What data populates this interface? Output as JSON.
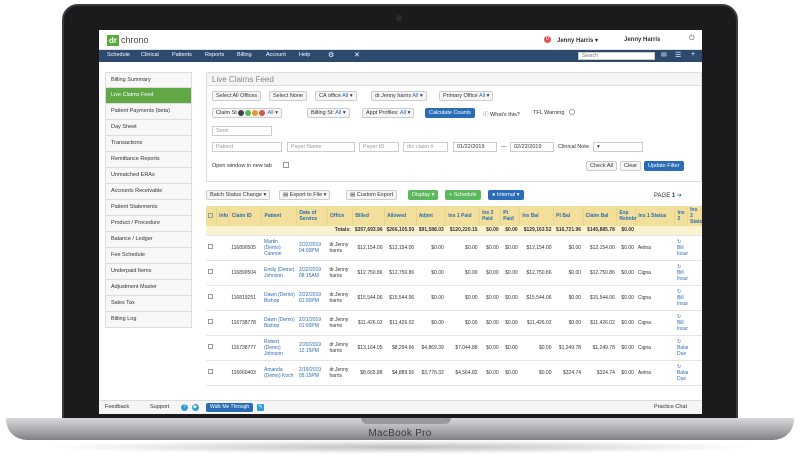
{
  "device": {
    "label": "MacBook Pro"
  },
  "app": {
    "logo_dr": "dr",
    "logo_chrono": "chrono",
    "notification_count": "0",
    "user_left": "Jenny Harris",
    "user_right": "Jenny Harris"
  },
  "nav": {
    "items": [
      "Schedule",
      "Clinical",
      "Patients",
      "Reports",
      "Billing",
      "Account",
      "Help"
    ],
    "search_placeholder": "Search"
  },
  "sidebar": {
    "items": [
      "Billing Summary",
      "Live Claims Feed",
      "Patient Payments (beta)",
      "Day Sheet",
      "Transactions",
      "Remittance Reports",
      "Unmatched ERAs",
      "Accounts Receivable",
      "Patient Statements",
      "Product / Procedure",
      "Balance / Ledger",
      "Fee Schedule",
      "Underpaid Items",
      "Adjustment Master",
      "Sales Tax",
      "Billing Log"
    ],
    "active": "Live Claims Feed"
  },
  "main": {
    "title": "Live Claims Feed",
    "select_all_offices": "Select All Offices",
    "select_none": "Select None",
    "ca_office_label": "CA office",
    "ca_office_value": "All",
    "doctor_label": "dr.Jenny harris",
    "doctor_value": "All",
    "primary_office_label": "Primary Office",
    "primary_office_value": "All",
    "claim_st_label": "Claim St",
    "claim_st_value": "All",
    "billing_st_label": "Billing St:",
    "billing_st_value": "All",
    "appt_profiles_label": "Appt Profiles:",
    "appt_profiles_value": "All",
    "calculate_counts": "Calculate Counts",
    "whats_this": "What's this?",
    "tfl_warning": "TFL Warning",
    "semi_placeholder": "Semi",
    "patient_placeholder": "Patient",
    "payer_name_placeholder": "Payer Name",
    "payer_id_placeholder": "Payer ID",
    "drc_claim_placeholder": "drc claim #",
    "date_from": "01/22/2019",
    "date_sep": "—",
    "date_to": "02/22/2019",
    "clinical_note_label": "Clinical Note",
    "open_window_label": "Open window in new tab",
    "check_all": "Check All",
    "clear": "Clear",
    "update_filter": "Update Filter",
    "batch_status": "Batch Status Change",
    "export_to_file": "Export to File",
    "custom_export": "Custom Export",
    "display": "Display",
    "schedule": "+ Schedule",
    "internal": "Internal",
    "page_label": "PAGE",
    "page_number": "1"
  },
  "table": {
    "headers": [
      "",
      "Info",
      "Claim ID",
      "Patient",
      "Date of Service",
      "Office",
      "Billed",
      "Allowed",
      "Adjmt",
      "Ins 1 Paid",
      "Ins 2 Paid",
      "Pt Paid",
      "Ins Bal",
      "Pt Bal",
      "Claim Bal",
      "Exp Reimbr",
      "Ins 1 Status",
      "Ins 2",
      "Ins 2 Statu"
    ],
    "totals": [
      "",
      "",
      "",
      "",
      "",
      "Totals:",
      "$357,693.96",
      "$266,105.93",
      "$91,588.03",
      "$120,220.15",
      "$0.00",
      "$0.00",
      "$129,163.52",
      "$16,721.96",
      "$145,885.78",
      "$0.00",
      "",
      "",
      ""
    ],
    "rows": [
      [
        "",
        "",
        "116890505",
        "Martin (Demo) Cannon",
        "2/22/2019 04:00PM",
        "dr.Jenny harris",
        "$12,154.00",
        "$12,154.00",
        "$0.00",
        "$0.00",
        "$0.00",
        "$0.00",
        "$12,154.00",
        "$0.00",
        "$12,154.00",
        "$0.00",
        "Aetna",
        "Bill Insurance",
        ""
      ],
      [
        "",
        "",
        "116890504",
        "Emily (Demo) Johnson",
        "2/22/2019 08:15AM",
        "dr.Jenny harris",
        "$12,750.86",
        "$12,750.86",
        "$0.00",
        "$0.00",
        "$0.00",
        "$0.00",
        "$12,750.86",
        "$0.00",
        "$12,750.86",
        "$0.00",
        "Cigna",
        "Bill Insurance",
        ""
      ],
      [
        "",
        "",
        "116819251",
        "Dawn (Demo) Bishop",
        "2/22/2019 01:00PM",
        "dr.Jenny harris",
        "$15,544.06",
        "$15,544.06",
        "$0.00",
        "$0.00",
        "$0.00",
        "$0.00",
        "$15,544.06",
        "$0.00",
        "$15,544.06",
        "$0.00",
        "Cigna",
        "Bill Insurance",
        ""
      ],
      [
        "",
        "",
        "116738778",
        "Dawn (Demo) Bishop",
        "2/21/2019 01:00PM",
        "dr.Jenny harris",
        "$11,426.02",
        "$11,426.02",
        "$0.00",
        "$0.00",
        "$0.00",
        "$0.00",
        "$11,426.02",
        "$0.00",
        "$11,426.02",
        "$0.00",
        "Cigna",
        "Bill Insurance",
        ""
      ],
      [
        "",
        "",
        "116738777",
        "Robert (Demo) Johnson",
        "2/20/2019 12:15PM",
        "dr.Jenny harris",
        "$13,164.05",
        "$8,294.66",
        "$4,869.39",
        "$7,044.88",
        "$0.00",
        "$0.00",
        "$0.00",
        "$1,249.78",
        "$1,249.78",
        "$0.00",
        "Cigna",
        "Balance Due",
        ""
      ],
      [
        "",
        "",
        "116660403",
        "Amanda (Demo) Koch",
        "2/19/2019 05:15PM",
        "dr.Jenny harris",
        "$8,665.88",
        "$4,889.56",
        "$3,776.32",
        "$4,564.82",
        "$0.00",
        "$0.00",
        "$0.00",
        "$324.74",
        "$324.74",
        "$0.00",
        "Aetna",
        "Balance Due",
        ""
      ]
    ]
  },
  "footer": {
    "feedback": "Feedback",
    "support": "Support",
    "walk_me_through": "Walk Me Through",
    "practice_chat": "Practice Chat"
  }
}
